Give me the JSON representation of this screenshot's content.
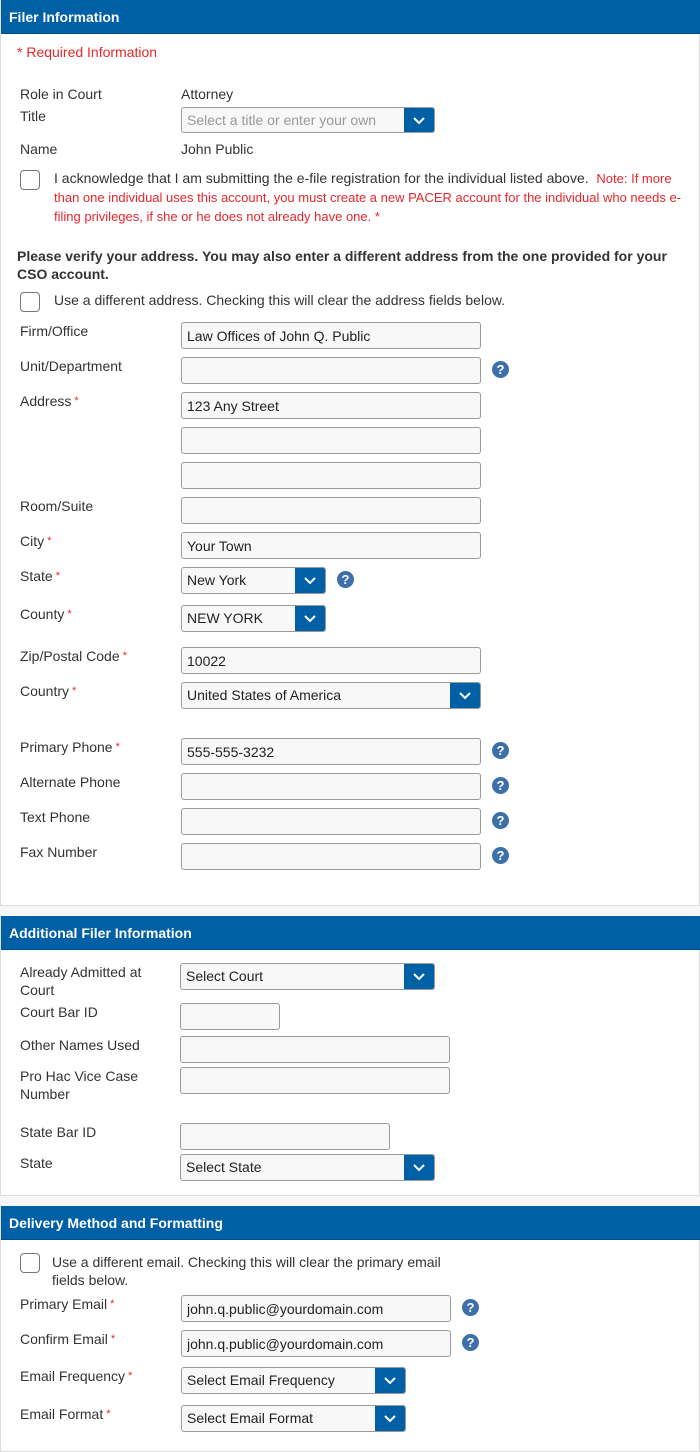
{
  "colors": {
    "header_bg": "#0060a6",
    "required": "#e8262c",
    "help_icon": "#3d6fa8"
  },
  "filer": {
    "header": "Filer Information",
    "required_info": "* Required Information",
    "role_label": "Role in Court",
    "role_value": "Attorney",
    "title_label": "Title",
    "title_placeholder": "Select a title or enter your own",
    "name_label": "Name",
    "name_value": "John Public",
    "ack_text": "I acknowledge that I am submitting the e-file registration for the individual listed above.",
    "ack_note": "Note: If more than one individual uses this account, you must create a new PACER account for the individual who needs e-filing privileges, if she or he does not already have one. *",
    "verify_text": "Please verify your address. You may also enter a different address from the one provided for your CSO account.",
    "diff_address_text": "Use a different address. Checking this will clear the address fields below.",
    "firm_label": "Firm/Office",
    "firm_value": "Law Offices of John Q. Public",
    "unit_label": "Unit/Department",
    "unit_value": "",
    "address_label": "Address",
    "address1_value": "123 Any Street",
    "address2_value": "",
    "address3_value": "",
    "room_label": "Room/Suite",
    "room_value": "",
    "city_label": "City",
    "city_value": "Your Town",
    "state_label": "State",
    "state_value": "New York",
    "county_label": "County",
    "county_value": "NEW YORK",
    "zip_label": "Zip/Postal Code",
    "zip_value": "10022",
    "country_label": "Country",
    "country_value": "United States of America",
    "primary_phone_label": "Primary Phone",
    "primary_phone_value": "555-555-3232",
    "alt_phone_label": "Alternate Phone",
    "alt_phone_value": "",
    "text_phone_label": "Text Phone",
    "text_phone_value": "",
    "fax_label": "Fax Number",
    "fax_value": ""
  },
  "additional": {
    "header": "Additional Filer Information",
    "admitted_label": "Already Admitted at Court",
    "admitted_value": "Select Court",
    "court_bar_label": "Court Bar ID",
    "court_bar_value": "",
    "other_names_label": "Other Names Used",
    "other_names_value": "",
    "pro_hac_label": "Pro Hac Vice Case Number",
    "pro_hac_value": "",
    "state_bar_label": "State Bar ID",
    "state_bar_value": "",
    "state_label": "State",
    "state_value": "Select State"
  },
  "delivery": {
    "header": "Delivery Method and Formatting",
    "diff_email_text": "Use a different email. Checking this will clear the primary email fields below.",
    "primary_email_label": "Primary Email",
    "primary_email_value": "john.q.public@yourdomain.com",
    "confirm_email_label": "Confirm Email",
    "confirm_email_value": "john.q.public@yourdomain.com",
    "frequency_label": "Email Frequency",
    "frequency_value": "Select Email Frequency",
    "format_label": "Email Format",
    "format_value": "Select Email Format"
  },
  "icons": {
    "help": "question-circle-icon",
    "dropdown": "chevron-down-icon",
    "required_marker": "*"
  }
}
